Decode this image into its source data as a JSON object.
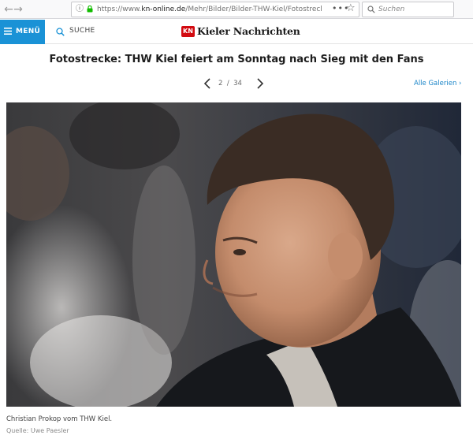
{
  "browser": {
    "url_prefix": "https://www.",
    "url_domain": "kn-online.de",
    "url_path": "/Mehr/Bilder/Bilder-THW-Kiel/Fotostrecke-TH",
    "more_actions": "•••",
    "search_placeholder": "Suchen"
  },
  "site": {
    "menu_label": "MENÜ",
    "search_label": "SUCHE",
    "logo_badge": "KN",
    "logo_name": "Kieler Nachrichten",
    "brand_color": "#1a92d6",
    "logo_color": "#d20b11"
  },
  "gallery": {
    "title": "Fotostrecke: THW Kiel feiert am Sonntag nach Sieg mit den Fans",
    "current": "2",
    "separator": "/",
    "total": "34",
    "all_galleries_label": "Alle Galerien ›",
    "caption": "Christian Prokop vom THW Kiel.",
    "source": "Quelle: Uwe Paesler"
  }
}
